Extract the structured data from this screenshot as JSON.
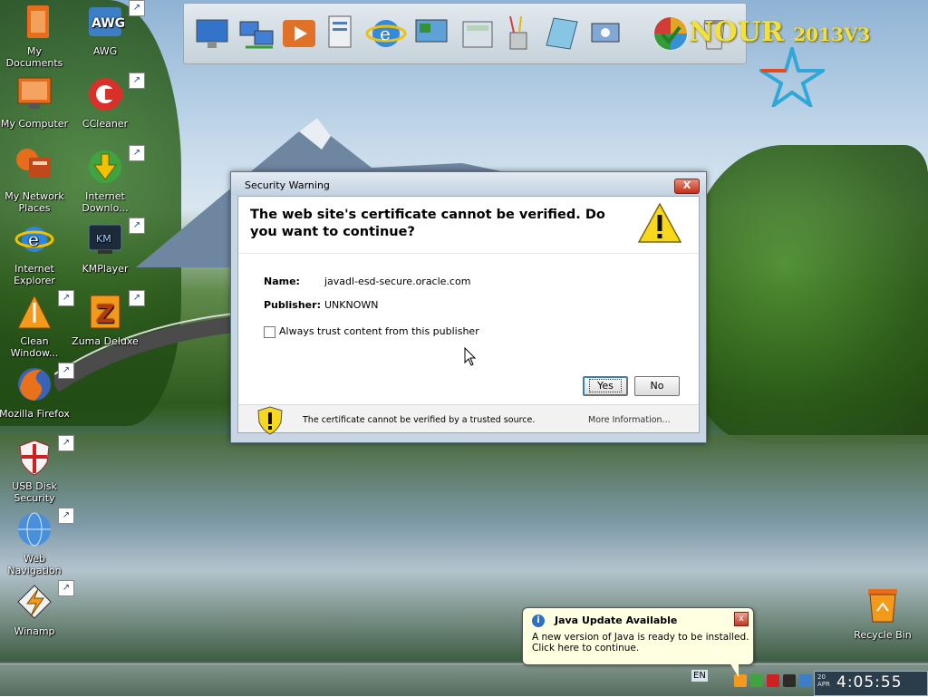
{
  "desktop": {
    "icons_left": [
      {
        "label": "My Documents"
      },
      {
        "label": "My Computer"
      },
      {
        "label": "My Network Places"
      },
      {
        "label": "Internet Explorer"
      },
      {
        "label": "Clean Window..."
      },
      {
        "label": "Mozilla Firefox"
      },
      {
        "label": "USB Disk Security"
      },
      {
        "label": "Web Navigation"
      },
      {
        "label": "Winamp"
      }
    ],
    "icons_second": [
      {
        "label": "AWG"
      },
      {
        "label": "CCleaner"
      },
      {
        "label": "Internet Downlo..."
      },
      {
        "label": "KMPlayer"
      },
      {
        "label": "Zuma Deluxe"
      }
    ],
    "recycle_bin": {
      "label": "Recycle Bin"
    },
    "brand_text": "NOUR",
    "brand_version": "2013V3"
  },
  "dock": {
    "items": [
      "monitor-icon",
      "network-computers-icon",
      "media-player-icon",
      "documents-icon",
      "internet-explorer-icon",
      "display-settings-icon",
      "calculator-icon",
      "paint-brushes-icon",
      "notepad-icon",
      "network-drive-icon",
      "windows-logo-icon",
      "recycle-bin-icon"
    ]
  },
  "dialog": {
    "title": "Security Warning",
    "close_label": "X",
    "headline": "The web site's certificate cannot be verified. Do you want to continue?",
    "name_label": "Name:",
    "name_value": "javadl-esd-secure.oracle.com",
    "publisher_label": "Publisher:",
    "publisher_value": "UNKNOWN",
    "checkbox_label": "Always trust content from this publisher",
    "yes_label": "Yes",
    "no_label": "No",
    "footer_text": "The certificate cannot be verified by a trusted source.",
    "more_info_label": "More Information..."
  },
  "balloon": {
    "title": "Java Update Available",
    "message": "A new version of Java is ready to be installed. Click here to continue.",
    "close_label": "x"
  },
  "taskbar": {
    "language": "EN",
    "clock": {
      "date_line1": "20",
      "date_line2": "APR",
      "time": "4:05:55"
    }
  },
  "colors": {
    "dialog_frame": "#c8d6e4",
    "close_red": "#c0311c",
    "balloon_bg": "#ffffe1",
    "brand_yellow": "#f0e040"
  }
}
